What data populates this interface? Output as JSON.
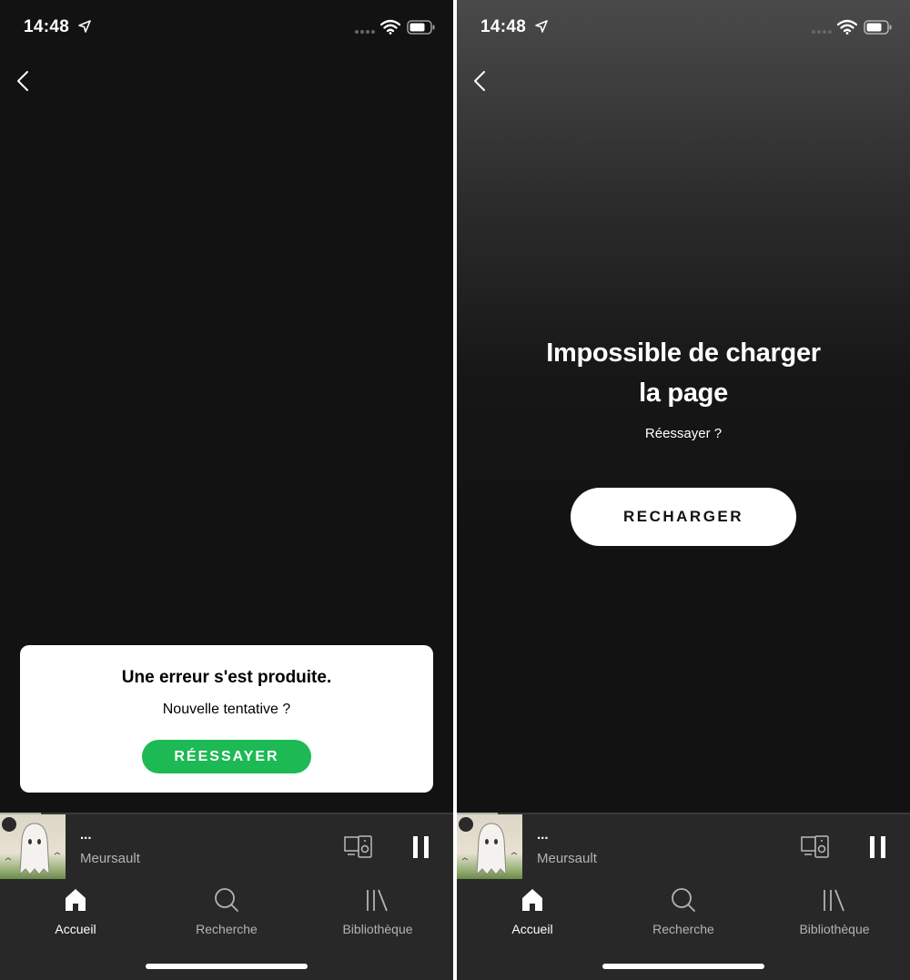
{
  "status_bar": {
    "time": "14:48"
  },
  "left_screen": {
    "error_card": {
      "title": "Une erreur s'est produite.",
      "subtitle": "Nouvelle tentative ?",
      "retry_label": "RÉESSAYER"
    }
  },
  "right_screen": {
    "load_error": {
      "title": "Impossible de charger la page",
      "subtitle": "Réessayer ?",
      "reload_label": "RECHARGER"
    }
  },
  "mini_player": {
    "track_title": "...",
    "artist": "Meursault",
    "progress": 0.09
  },
  "nav": {
    "home": "Accueil",
    "search": "Recherche",
    "library": "Bibliothèque"
  },
  "colors": {
    "accent": "#1db954",
    "background": "#121212",
    "player_bg": "#282828"
  },
  "icons": [
    "location-arrow-icon",
    "wifi-icon",
    "battery-icon",
    "back-chevron-icon",
    "devices-icon",
    "pause-icon",
    "home-icon",
    "search-icon",
    "library-icon"
  ]
}
